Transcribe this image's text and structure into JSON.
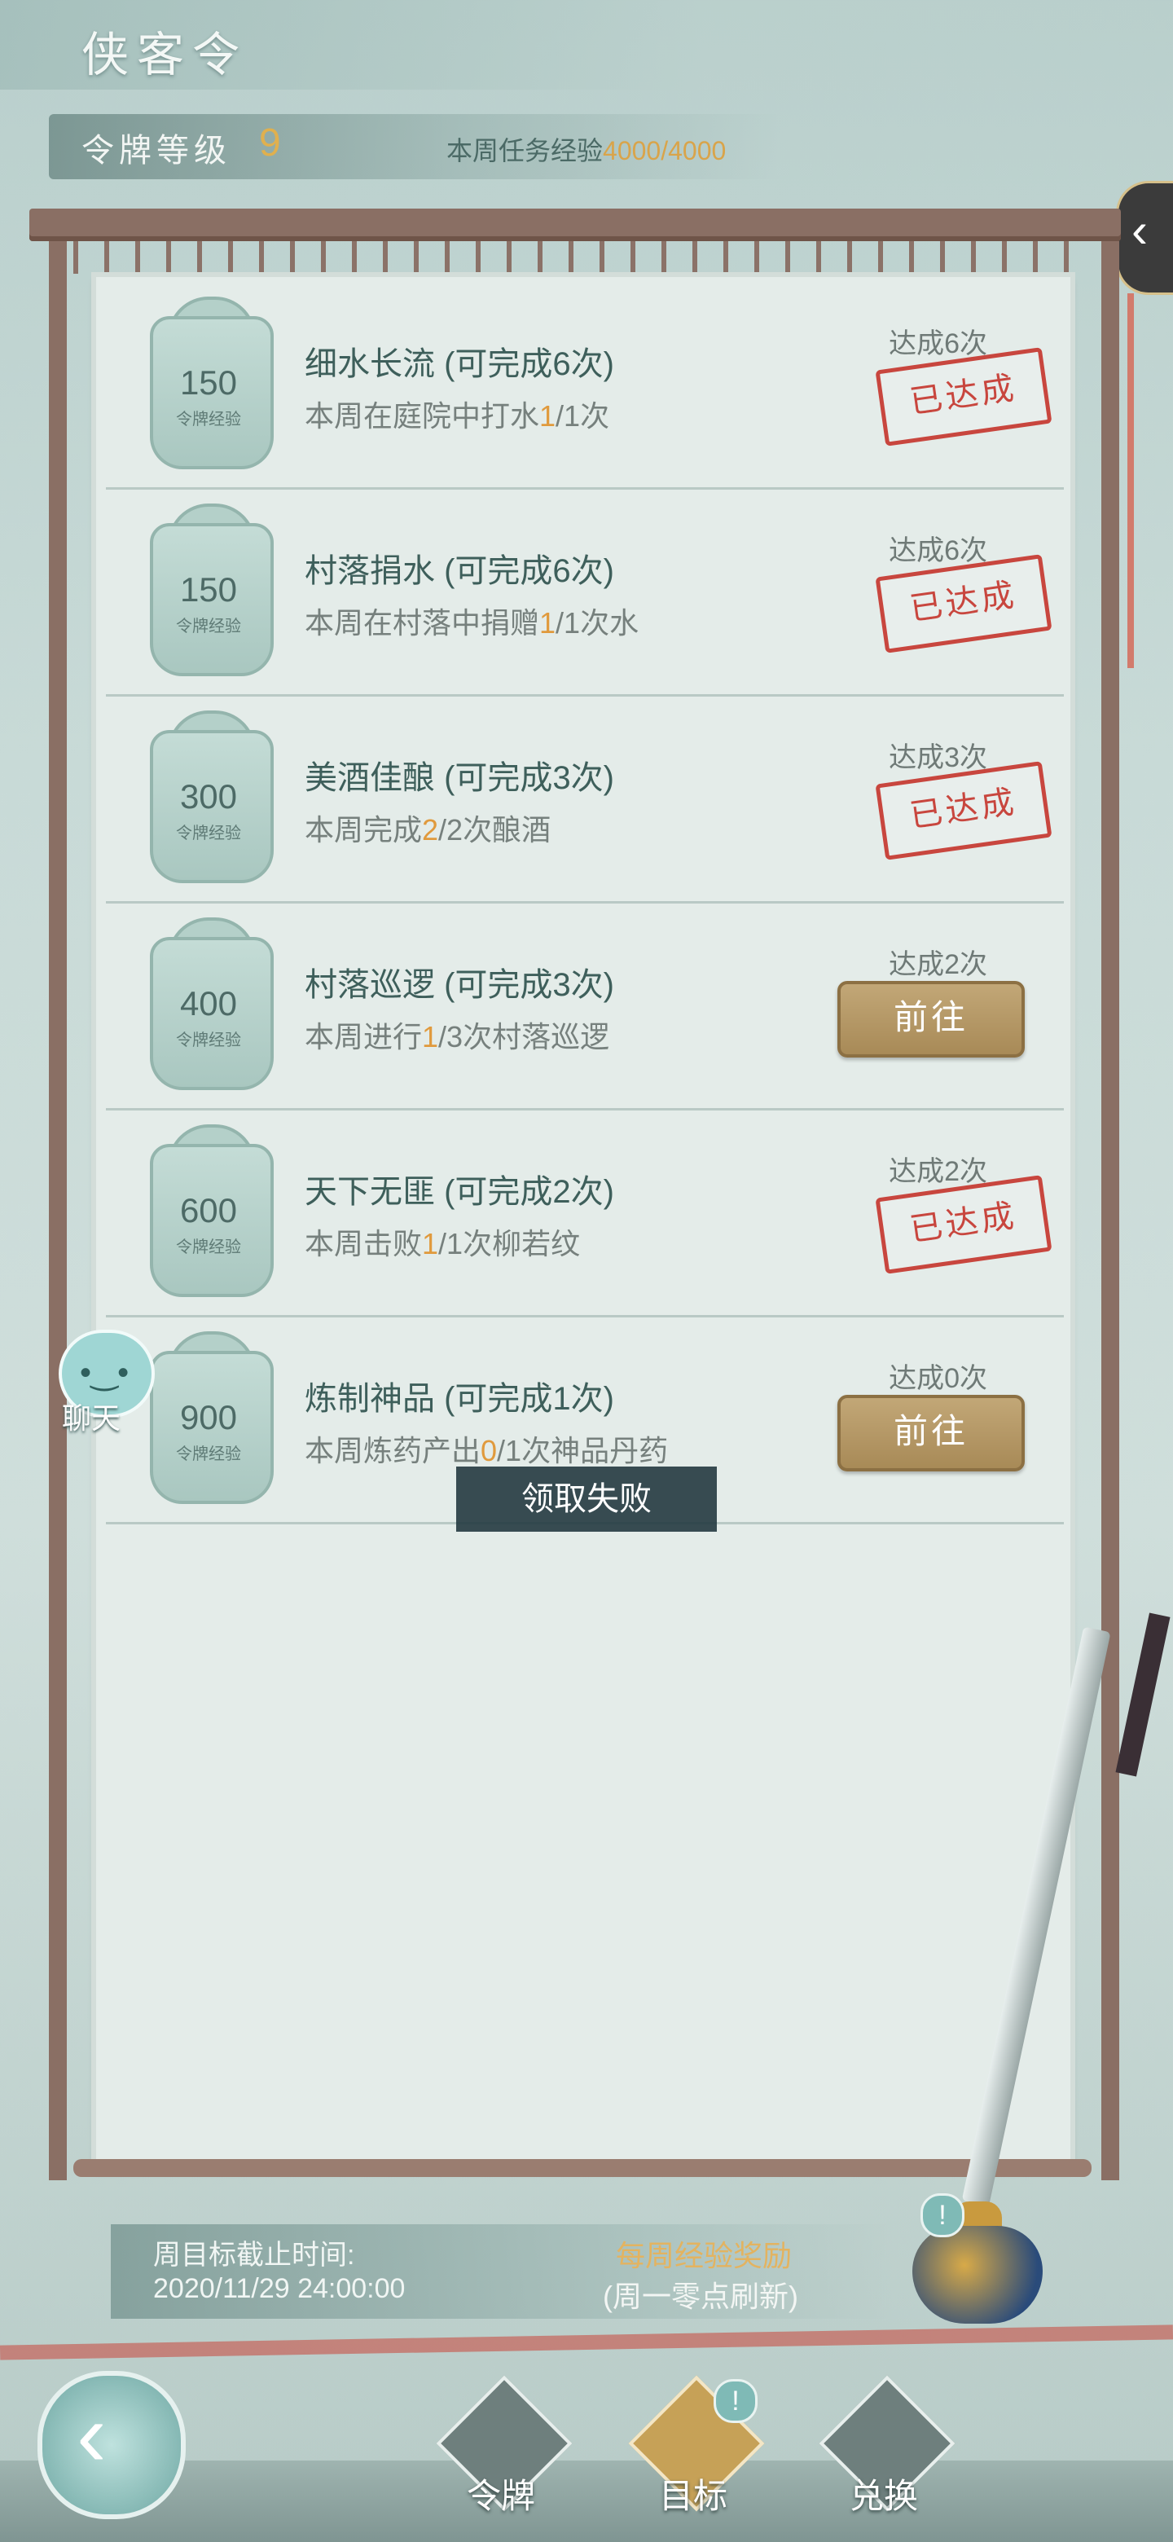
{
  "header": {
    "title": "侠客令",
    "level_label": "令牌等级",
    "level_value": "9",
    "week_exp_label": "本周任务经验",
    "week_exp_value": "4000/4000"
  },
  "tasks": [
    {
      "exp": "150",
      "exp_sub": "令牌经验",
      "title": "细水长流 (可完成6次)",
      "desc_pre": "本周在庭院中打水",
      "progress": "1",
      "desc_post": "/1次",
      "done": "达成6次",
      "status": "已达成"
    },
    {
      "exp": "150",
      "exp_sub": "令牌经验",
      "title": "村落捐水 (可完成6次)",
      "desc_pre": "本周在村落中捐赠",
      "progress": "1",
      "desc_post": "/1次水",
      "done": "达成6次",
      "status": "已达成"
    },
    {
      "exp": "300",
      "exp_sub": "令牌经验",
      "title": "美酒佳酿 (可完成3次)",
      "desc_pre": "本周完成",
      "progress": "2",
      "desc_post": "/2次酿酒",
      "done": "达成3次",
      "status": "已达成"
    },
    {
      "exp": "400",
      "exp_sub": "令牌经验",
      "title": "村落巡逻 (可完成3次)",
      "desc_pre": "本周进行",
      "progress": "1",
      "desc_post": "/3次村落巡逻",
      "done": "达成2次",
      "action": "前往"
    },
    {
      "exp": "600",
      "exp_sub": "令牌经验",
      "title": "天下无匪 (可完成2次)",
      "desc_pre": "本周击败",
      "progress": "1",
      "desc_post": "/1次柳若纹",
      "done": "达成2次",
      "status": "已达成"
    },
    {
      "exp": "900",
      "exp_sub": "令牌经验",
      "title": "炼制神品 (可完成1次)",
      "desc_pre": "本周炼药产出",
      "progress": "0",
      "desc_post": "/1次神品丹药",
      "done": "达成0次",
      "action": "前往"
    }
  ],
  "toast": "领取失败",
  "chat_label": "聊天",
  "footer": {
    "deadline_label": "周目标截止时间:",
    "deadline_time": "2020/11/29 24:00:00",
    "reward_title": "每周经验奖励",
    "reward_sub": "(周一零点刷新)",
    "alert_mark": "!"
  },
  "nav": [
    {
      "label": "令牌",
      "icon": "token-icon",
      "active": false
    },
    {
      "label": "目标",
      "icon": "target-icon",
      "active": true
    },
    {
      "label": "兑换",
      "icon": "exchange-icon",
      "active": false
    }
  ],
  "icons": {
    "side_tab": "chevron-left-icon",
    "back": "back-arrow-icon",
    "bag": "reward-bag-icon"
  },
  "colors": {
    "accent_gold": "#e0b04e",
    "stamp_red": "#c8463e",
    "progress_orange": "#e09a3d"
  }
}
